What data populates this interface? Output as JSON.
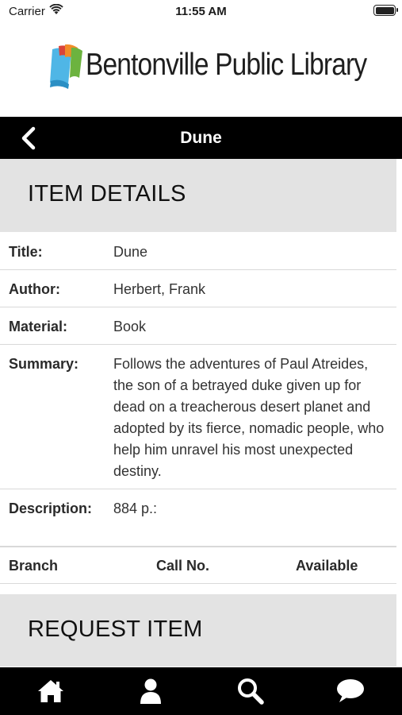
{
  "status_bar": {
    "carrier": "Carrier",
    "time": "11:55 AM"
  },
  "header": {
    "library_name": "Bentonville Public Library"
  },
  "nav": {
    "title": "Dune"
  },
  "sections": {
    "details_heading": "ITEM DETAILS",
    "request_heading": "REQUEST ITEM"
  },
  "details": {
    "title_label": "Title:",
    "title_value": "Dune",
    "author_label": "Author:",
    "author_value": "Herbert, Frank",
    "material_label": "Material:",
    "material_value": "Book",
    "summary_label": "Summary:",
    "summary_value": "Follows the adventures of Paul Atreides, the son of a betrayed duke given up for dead on a treacherous desert planet and adopted by its fierce, nomadic people, who help him unravel his most unexpected destiny.",
    "description_label": "Description:",
    "description_value": "884 p.:"
  },
  "holdings": {
    "columns": [
      "Branch",
      "Call No.",
      "Available"
    ]
  },
  "tabs": [
    "home-icon",
    "account-icon",
    "search-icon",
    "chat-icon"
  ],
  "colors": {
    "nav_background": "#000000",
    "section_background": "#e3e3e3",
    "logo_blue": "#4fb6e6",
    "logo_orange": "#f28c28",
    "logo_green": "#6cb33f",
    "logo_red": "#d9443a"
  }
}
